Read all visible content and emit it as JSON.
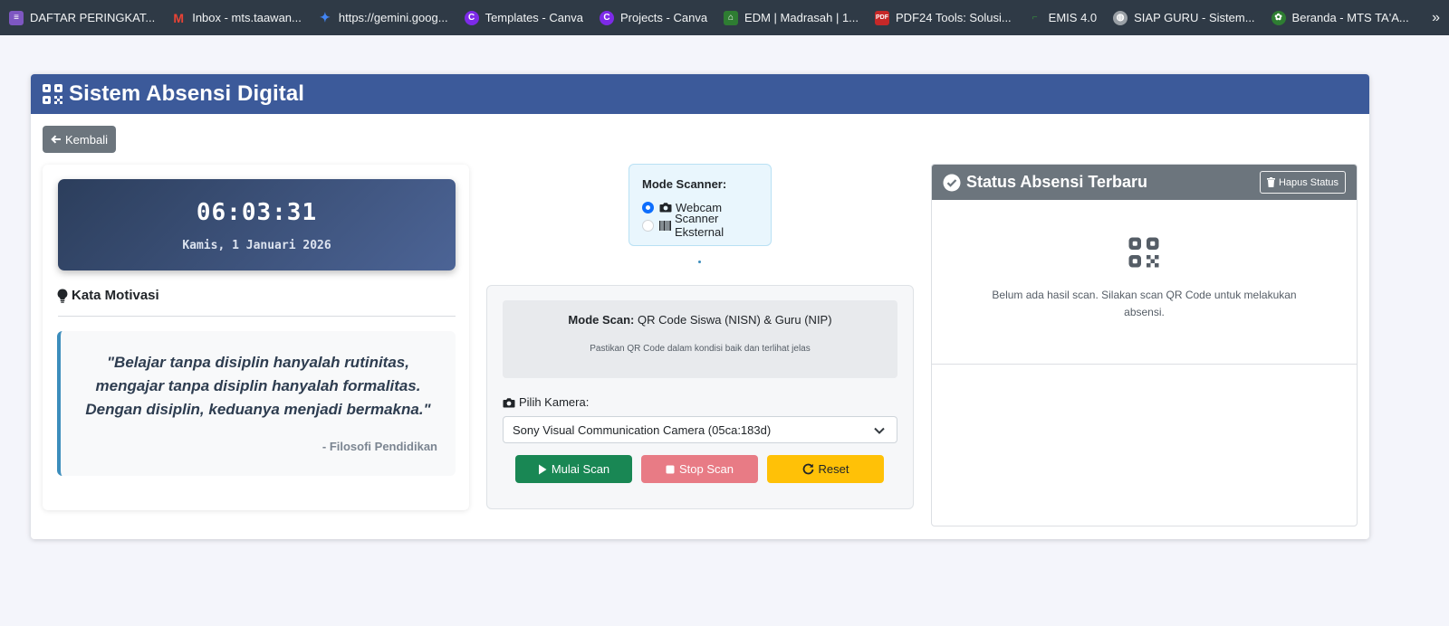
{
  "bookmarks": [
    {
      "label": "DAFTAR PERINGKAT...",
      "icon": "list-icon",
      "color": "#7e57c2"
    },
    {
      "label": "Inbox - mts.taawan...",
      "icon": "gmail-icon",
      "color": "#ea4335"
    },
    {
      "label": "https://gemini.goog...",
      "icon": "gemini-icon",
      "color": "#4285f4"
    },
    {
      "label": "Templates - Canva",
      "icon": "canva-icon",
      "color": "#7d2ae8"
    },
    {
      "label": "Projects - Canva",
      "icon": "canva-icon",
      "color": "#7d2ae8"
    },
    {
      "label": "EDM | Madrasah | 1...",
      "icon": "edm-icon",
      "color": "#2e7d32"
    },
    {
      "label": "PDF24 Tools: Solusi...",
      "icon": "pdf24-icon",
      "color": "#c62828"
    },
    {
      "label": "EMIS 4.0",
      "icon": "emis-icon",
      "color": "#388e3c"
    },
    {
      "label": "SIAP GURU - Sistem...",
      "icon": "globe-icon",
      "color": "#9aa0a6"
    },
    {
      "label": "Beranda - MTS TA'A...",
      "icon": "school-icon",
      "color": "#2e7d32"
    }
  ],
  "header": {
    "title": "Sistem Absensi Digital"
  },
  "back_button": "Kembali",
  "clock": {
    "time": "06:03:31",
    "date": "Kamis, 1 Januari 2026"
  },
  "motivation": {
    "title": "Kata Motivasi",
    "quote": "\"Belajar tanpa disiplin hanyalah rutinitas, mengajar tanpa disiplin hanyalah formalitas. Dengan disiplin, keduanya menjadi bermakna.\"",
    "source": "- Filosofi Pendidikan"
  },
  "scanner_mode": {
    "title": "Mode Scanner:",
    "options": [
      {
        "label": "Webcam",
        "selected": true
      },
      {
        "label": "Scanner Eksternal",
        "selected": false
      }
    ]
  },
  "scan": {
    "mode_label": "Mode Scan:",
    "mode_value": "QR Code Siswa (NISN) & Guru (NIP)",
    "hint": "Pastikan QR Code dalam kondisi baik dan terlihat jelas",
    "camera_label": "Pilih Kamera:",
    "camera_selected": "Sony Visual Communication Camera (05ca:183d)",
    "start_button": "Mulai Scan",
    "stop_button": "Stop Scan",
    "reset_button": "Reset"
  },
  "status": {
    "title": "Status Absensi Terbaru",
    "clear_button": "Hapus Status",
    "empty_message": "Belum ada hasil scan. Silakan scan QR Code untuk melakukan absensi."
  },
  "colors": {
    "header_bg": "#3c5a9a",
    "status_header_bg": "#6c757d",
    "start": "#198754",
    "stop": "#e87b85",
    "reset": "#ffc107",
    "quote_border": "#3c8dbc"
  }
}
